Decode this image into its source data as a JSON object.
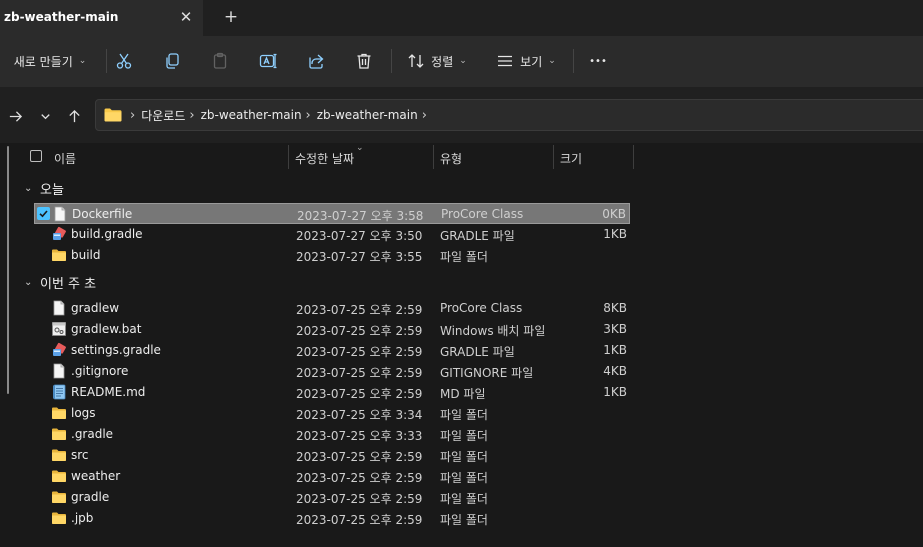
{
  "tab": {
    "title": "zb-weather-main",
    "close": "✕",
    "new": "+"
  },
  "toolbar": {
    "new_label": "새로 만들기",
    "sort_label": "정렬",
    "view_label": "보기",
    "more": "•••",
    "chevron": "⌄",
    "icons": [
      "cut-icon",
      "copy-icon",
      "paste-icon",
      "rename-icon",
      "share-icon",
      "delete-icon",
      "sort-icon",
      "view-icon",
      "more-icon"
    ]
  },
  "address": {
    "sep": "›",
    "crumbs": [
      "다운로드",
      "zb-weather-main",
      "zb-weather-main"
    ]
  },
  "columns": {
    "name": "이름",
    "date": "수정한 날짜",
    "type": "유형",
    "size": "크기"
  },
  "colors": {
    "accent": "#4cc2ff",
    "folder": "#f8c94a",
    "selected_row": "#777777"
  },
  "groups": [
    {
      "name": "오늘",
      "files": [
        {
          "name": "Dockerfile",
          "date": "2023-07-27 오후 3:58",
          "type": "ProCore Class",
          "size": "0KB",
          "icon": "file-icon",
          "selected": true
        },
        {
          "name": "build.gradle",
          "date": "2023-07-27 오후 3:50",
          "type": "GRADLE 파일",
          "size": "1KB",
          "icon": "gradle-file-icon"
        },
        {
          "name": "build",
          "date": "2023-07-27 오후 3:55",
          "type": "파일 폴더",
          "size": "",
          "icon": "folder-icon"
        }
      ]
    },
    {
      "name": "이번 주 초",
      "files": [
        {
          "name": "gradlew",
          "date": "2023-07-25 오후 2:59",
          "type": "ProCore Class",
          "size": "8KB",
          "icon": "file-icon"
        },
        {
          "name": "gradlew.bat",
          "date": "2023-07-25 오후 2:59",
          "type": "Windows 배치 파일",
          "size": "3KB",
          "icon": "batch-file-icon"
        },
        {
          "name": "settings.gradle",
          "date": "2023-07-25 오후 2:59",
          "type": "GRADLE 파일",
          "size": "1KB",
          "icon": "gradle-file-icon"
        },
        {
          "name": ".gitignore",
          "date": "2023-07-25 오후 2:59",
          "type": "GITIGNORE 파일",
          "size": "4KB",
          "icon": "file-icon"
        },
        {
          "name": "README.md",
          "date": "2023-07-25 오후 2:59",
          "type": "MD 파일",
          "size": "1KB",
          "icon": "markdown-file-icon"
        },
        {
          "name": "logs",
          "date": "2023-07-25 오후 3:34",
          "type": "파일 폴더",
          "size": "",
          "icon": "folder-icon"
        },
        {
          "name": ".gradle",
          "date": "2023-07-25 오후 3:33",
          "type": "파일 폴더",
          "size": "",
          "icon": "folder-icon"
        },
        {
          "name": "src",
          "date": "2023-07-25 오후 2:59",
          "type": "파일 폴더",
          "size": "",
          "icon": "folder-icon"
        },
        {
          "name": "weather",
          "date": "2023-07-25 오후 2:59",
          "type": "파일 폴더",
          "size": "",
          "icon": "folder-icon"
        },
        {
          "name": "gradle",
          "date": "2023-07-25 오후 2:59",
          "type": "파일 폴더",
          "size": "",
          "icon": "folder-icon"
        },
        {
          "name": ".jpb",
          "date": "2023-07-25 오후 2:59",
          "type": "파일 폴더",
          "size": "",
          "icon": "folder-icon"
        }
      ]
    }
  ]
}
